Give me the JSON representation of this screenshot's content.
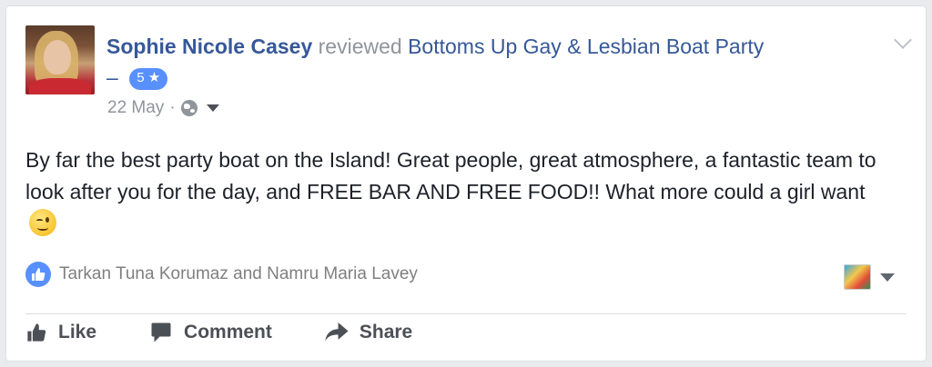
{
  "post": {
    "author": "Sophie Nicole Casey",
    "verb": "reviewed",
    "page": "Bottoms Up Gay & Lesbian Boat Party",
    "dash": "–",
    "rating": "5 ★",
    "date": "22 May",
    "separator": "·",
    "body_text": "By far the best party boat on the Island! Great people, great atmosphere, a fantastic team to look after you for the day, and FREE BAR AND FREE FOOD!! What more could a girl want",
    "emoji": "winking-face"
  },
  "reactions": {
    "names": "Tarkan Tuna Korumaz and Namru Maria Lavey"
  },
  "actions": {
    "like": "Like",
    "comment": "Comment",
    "share": "Share"
  },
  "colors": {
    "link_blue": "#365899",
    "rating_blue": "#5890ff",
    "text_dark": "#1d2129",
    "text_muted": "#90949c"
  }
}
